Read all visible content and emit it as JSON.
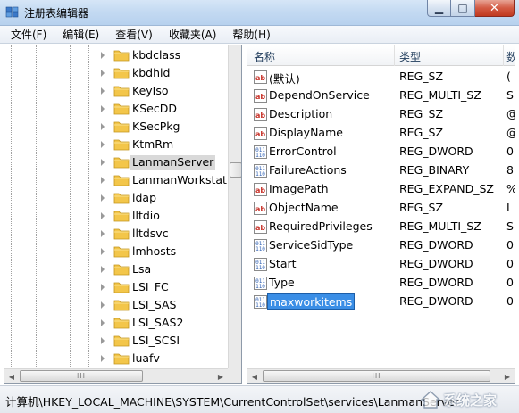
{
  "window": {
    "title": "注册表编辑器",
    "controls": {
      "minimize": "▁",
      "maximize": "□",
      "close": "✕"
    }
  },
  "menubar": {
    "items": [
      "文件(F)",
      "编辑(E)",
      "查看(V)",
      "收藏夹(A)",
      "帮助(H)"
    ]
  },
  "tree": {
    "selected": "LanmanServer",
    "items": [
      "kbdclass",
      "kbdhid",
      "KeyIso",
      "KSecDD",
      "KSecPkg",
      "KtmRm",
      "LanmanServer",
      "LanmanWorkstatio",
      "ldap",
      "lltdio",
      "lltdsvc",
      "lmhosts",
      "Lsa",
      "LSI_FC",
      "LSI_SAS",
      "LSI_SAS2",
      "LSI_SCSI",
      "luafv"
    ],
    "scroll_grip": "III"
  },
  "values": {
    "columns": {
      "name": "名称",
      "type": "类型",
      "data": "数"
    },
    "rows": [
      {
        "name": "(默认)",
        "type": "REG_SZ",
        "data": "(",
        "icon": "string-value-icon"
      },
      {
        "name": "DependOnService",
        "type": "REG_MULTI_SZ",
        "data": "S",
        "icon": "string-value-icon"
      },
      {
        "name": "Description",
        "type": "REG_SZ",
        "data": "@",
        "icon": "string-value-icon"
      },
      {
        "name": "DisplayName",
        "type": "REG_SZ",
        "data": "@",
        "icon": "string-value-icon"
      },
      {
        "name": "ErrorControl",
        "type": "REG_DWORD",
        "data": "0",
        "icon": "binary-value-icon"
      },
      {
        "name": "FailureActions",
        "type": "REG_BINARY",
        "data": "8",
        "icon": "binary-value-icon"
      },
      {
        "name": "ImagePath",
        "type": "REG_EXPAND_SZ",
        "data": "%",
        "icon": "string-value-icon"
      },
      {
        "name": "ObjectName",
        "type": "REG_SZ",
        "data": "L",
        "icon": "string-value-icon"
      },
      {
        "name": "RequiredPrivileges",
        "type": "REG_MULTI_SZ",
        "data": "S",
        "icon": "string-value-icon"
      },
      {
        "name": "ServiceSidType",
        "type": "REG_DWORD",
        "data": "0",
        "icon": "binary-value-icon"
      },
      {
        "name": "Start",
        "type": "REG_DWORD",
        "data": "0",
        "icon": "binary-value-icon"
      },
      {
        "name": "Type",
        "type": "REG_DWORD",
        "data": "0",
        "icon": "binary-value-icon"
      },
      {
        "name": "maxworkitems",
        "type": "REG_DWORD",
        "data": "0",
        "icon": "binary-value-icon",
        "editing": true
      }
    ],
    "scroll_grip": "III"
  },
  "statusbar": {
    "path": "计算机\\HKEY_LOCAL_MACHINE\\SYSTEM\\CurrentControlSet\\services\\LanmanServer"
  },
  "watermark": {
    "text": "系统之家"
  },
  "colors": {
    "selection": "#3a8ee6",
    "title_bar": "#c4daf2",
    "folder": "#f3c64a",
    "string_icon": "#c8332a",
    "binary_icon": "#2d5fb3"
  }
}
